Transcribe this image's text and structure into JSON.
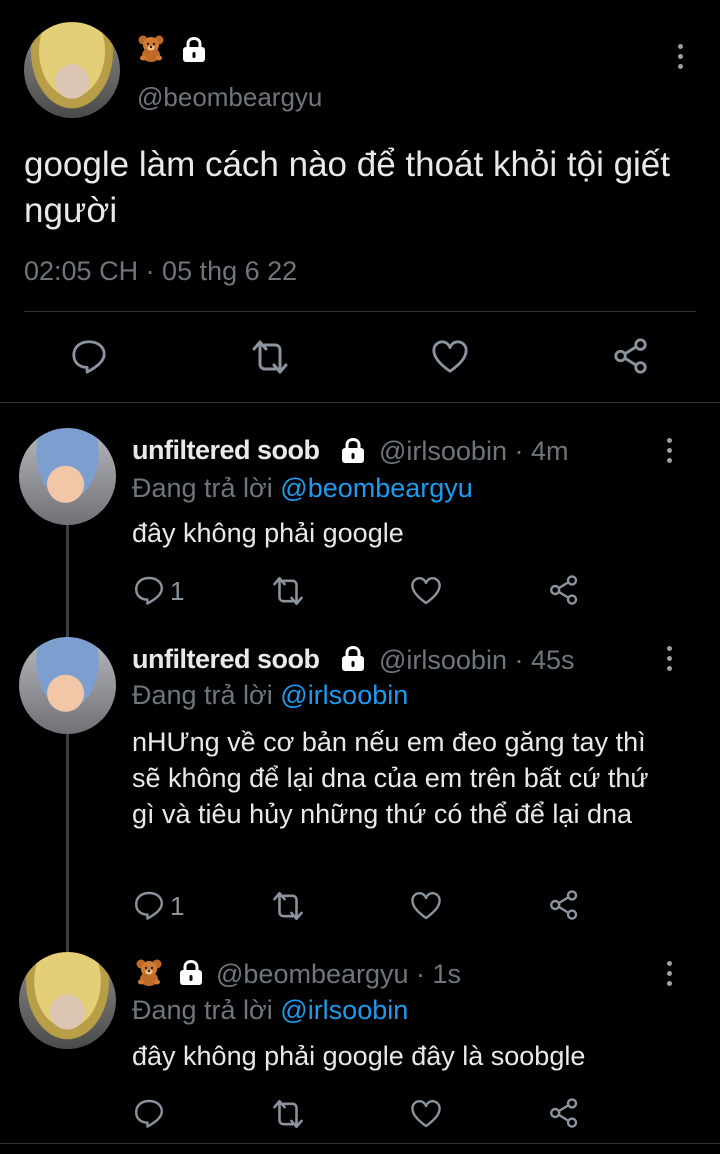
{
  "main_tweet": {
    "handle": "@beombeargyu",
    "text": "google làm cách nào để thoát khỏi tội giết người",
    "timestamp": "02:05 CH · 05 thg 6 22"
  },
  "replies": [
    {
      "display_name": "unfiltered soob",
      "handle": "@irlsoobin",
      "time": "· 4m",
      "replying_label": "Đang trả lời",
      "replying_to": "@beombeargyu",
      "text": "đây không phải google",
      "reply_count": "1"
    },
    {
      "display_name": "unfiltered soob",
      "handle": "@irlsoobin",
      "time": "· 45s",
      "replying_label": "Đang trả lời",
      "replying_to": "@irlsoobin",
      "text": "nHƯng về cơ bản nếu em đeo găng tay thì sẽ không để lại dna của em trên bất cứ thứ gì và tiêu hủy những thứ có thể để lại dna",
      "reply_count": "1"
    },
    {
      "display_name": "",
      "handle": "@beombeargyu",
      "time": "· 1s",
      "replying_label": "Đang trả lời",
      "replying_to": "@irlsoobin",
      "text": "đây không phải google đây là soobgle",
      "reply_count": ""
    }
  ],
  "icons": [
    "reply-icon",
    "retweet-icon",
    "like-icon",
    "share-icon",
    "lock-icon",
    "teddy-bear-icon",
    "more-options-icon"
  ],
  "colors": {
    "background": "#000000",
    "text": "#e7e9ea",
    "muted": "#6e767d",
    "link": "#1d9bf0"
  }
}
